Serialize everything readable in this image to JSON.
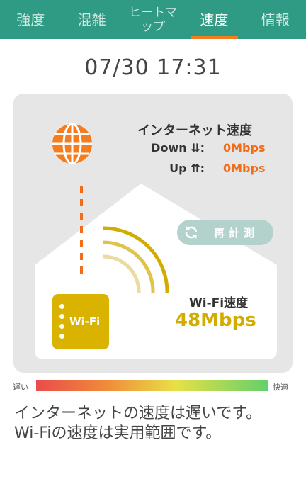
{
  "tabs": [
    {
      "label": "強度",
      "active": false
    },
    {
      "label": "混雑",
      "active": false
    },
    {
      "label": "ヒートマップ",
      "active": false
    },
    {
      "label": "速度",
      "active": true
    },
    {
      "label": "情報",
      "active": false
    }
  ],
  "datetime": "07/30 17:31",
  "internet": {
    "title": "インターネット速度",
    "down_label": "Down ⇊:",
    "down_value": "0Mbps",
    "up_label": "Up ⇈:",
    "up_value": "0Mbps"
  },
  "remeasure_label": "再計測",
  "router_label": "Wi-Fi",
  "wifi": {
    "label": "Wi-Fi速度",
    "value": "48Mbps"
  },
  "scale": {
    "left": "遅い",
    "right": "快適"
  },
  "message": {
    "line1": "インターネットの速度は遅いです。",
    "line2": "Wi-Fiの速度は実用範囲です。"
  },
  "colors": {
    "tabbar": "#2f9b85",
    "tab_indicator": "#f57c1f",
    "internet_value": "#f26d1a",
    "wifi_value": "#d2ad00",
    "router": "#d9b300",
    "globe": "#f57c1f",
    "remeasure_bg": "#b4d2cc"
  },
  "icons": {
    "globe": "globe-icon",
    "refresh": "refresh-icon",
    "wifi_waves": "wifi-signal-icon",
    "router": "router-icon"
  }
}
